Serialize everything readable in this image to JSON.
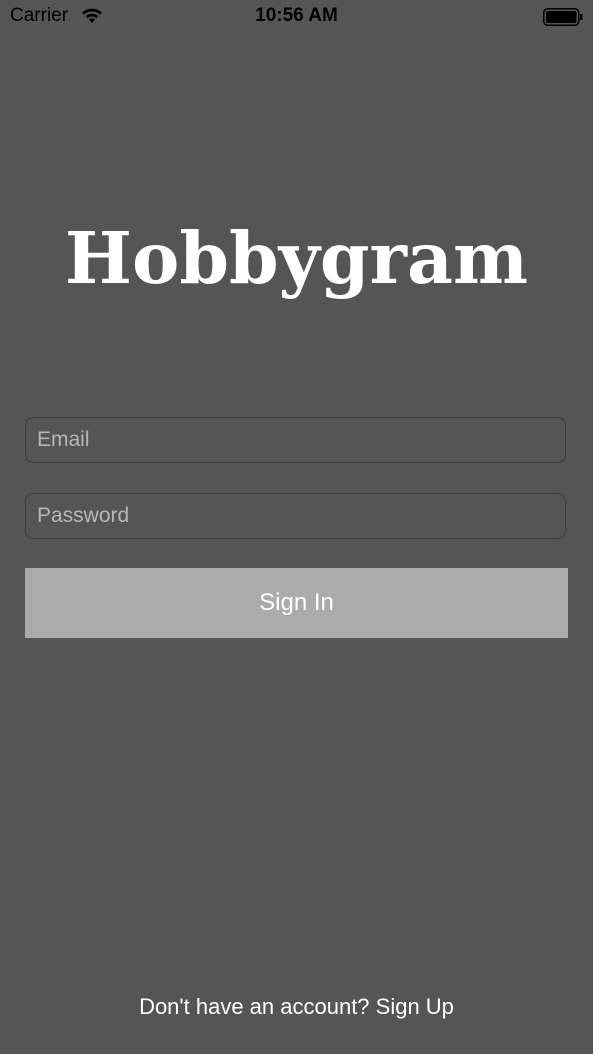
{
  "status_bar": {
    "carrier": "Carrier",
    "time": "10:56 AM",
    "icons": [
      "wifi-icon",
      "battery-icon"
    ]
  },
  "app": {
    "title": "Hobbygram"
  },
  "form": {
    "email_placeholder": "Email",
    "email_value": "",
    "password_placeholder": "Password",
    "password_value": "",
    "sign_in_label": "Sign In"
  },
  "footer": {
    "signup_text": "Don't have an account? Sign Up"
  },
  "colors": {
    "background": "#555555",
    "button_background": "#ababab",
    "text": "#ffffff",
    "placeholder": "#b6b6b6"
  }
}
